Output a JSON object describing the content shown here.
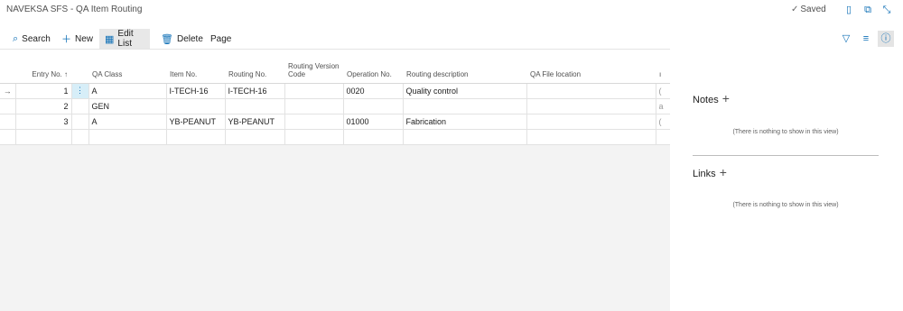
{
  "app": {
    "title": "NAVEKSA SFS - QA Item Routing",
    "saved_label": "Saved"
  },
  "toolbar": {
    "search": "Search",
    "new": "New",
    "edit_list": "Edit List",
    "delete": "Delete",
    "page": "Page"
  },
  "columns": [
    "Entry No. ↑",
    "QA Class",
    "Item No.",
    "Routing No.",
    "Routing Version Code",
    "Operation No.",
    "Routing description",
    "QA File location"
  ],
  "rows": [
    {
      "entry": "1",
      "qa_class": "A",
      "item_no": "I-TECH-16",
      "routing_no": "I-TECH-16",
      "version": "",
      "operation": "0020",
      "description": "Quality control",
      "file": "",
      "trail": "("
    },
    {
      "entry": "2",
      "qa_class": "GEN",
      "item_no": "",
      "routing_no": "",
      "version": "",
      "operation": "",
      "description": "",
      "file": "",
      "trail": "a"
    },
    {
      "entry": "3",
      "qa_class": "A",
      "item_no": "YB-PEANUT",
      "routing_no": "YB-PEANUT",
      "version": "",
      "operation": "01000",
      "description": "Fabrication",
      "file": "",
      "trail": "("
    }
  ],
  "factbox": {
    "notes_title": "Notes",
    "notes_empty": "(There is nothing to show in this view)",
    "links_title": "Links",
    "links_empty": "(There is nothing to show in this view)"
  }
}
